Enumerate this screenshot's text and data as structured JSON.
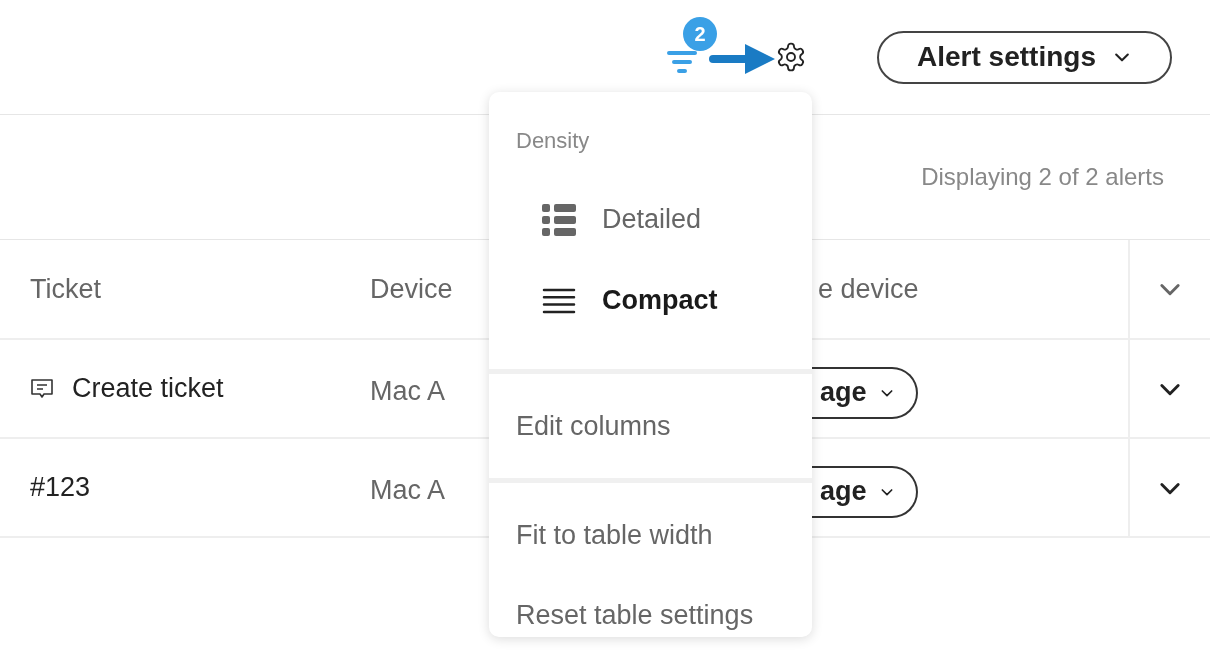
{
  "toolbar": {
    "filter_badge": "2",
    "alert_settings_button": "Alert settings"
  },
  "summary": "Displaying 2 of 2 alerts",
  "table": {
    "columns": [
      "Ticket",
      "Device",
      "e device"
    ],
    "rows": [
      {
        "kind": "create",
        "ticket": "Create ticket",
        "device": "Mac A",
        "action": "age"
      },
      {
        "kind": "number",
        "ticket": "#123",
        "device": "Mac A",
        "action": "age"
      }
    ]
  },
  "menu": {
    "section": "Density",
    "density_options": [
      {
        "label": "Detailed",
        "kind": "detailed",
        "selected": false
      },
      {
        "label": "Compact",
        "kind": "compact",
        "selected": true
      }
    ],
    "actions": [
      [
        "Edit columns"
      ],
      [
        "Fit to table width",
        "Reset table settings"
      ]
    ]
  }
}
